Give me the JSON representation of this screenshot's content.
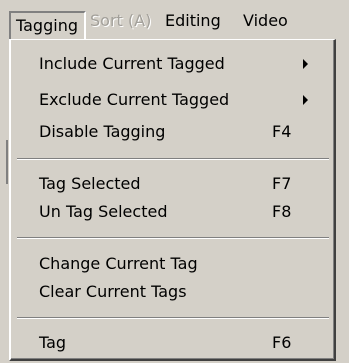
{
  "menubar": {
    "items": [
      {
        "label": "Tagging",
        "state": "open"
      },
      {
        "label": "Sort (A)",
        "state": "disabled"
      },
      {
        "label": "Editing",
        "state": "normal"
      },
      {
        "label": "Video",
        "state": "normal"
      }
    ]
  },
  "dropdown": {
    "items": [
      {
        "label": "Include Current Tagged",
        "shortcut": "",
        "submenu": true,
        "icon": "chevron-right-icon"
      },
      {
        "label": "Exclude Current Tagged",
        "shortcut": "",
        "submenu": true,
        "icon": "chevron-right-icon"
      },
      {
        "label": "Disable Tagging",
        "shortcut": "F4",
        "submenu": false
      },
      {
        "label": "Tag Selected",
        "shortcut": "F7",
        "submenu": false
      },
      {
        "label": "Un Tag  Selected",
        "shortcut": "F8",
        "submenu": false
      },
      {
        "label": "Change Current Tag",
        "shortcut": "",
        "submenu": false
      },
      {
        "label": "Clear Current Tags",
        "shortcut": "",
        "submenu": false
      },
      {
        "label": "Tag",
        "shortcut": "F6",
        "submenu": false
      }
    ]
  },
  "colors": {
    "face": "#d4d0c8",
    "shadow": "#808080",
    "dark_shadow": "#404040",
    "highlight": "#ffffff",
    "disabled_text": "#a3a09a"
  }
}
